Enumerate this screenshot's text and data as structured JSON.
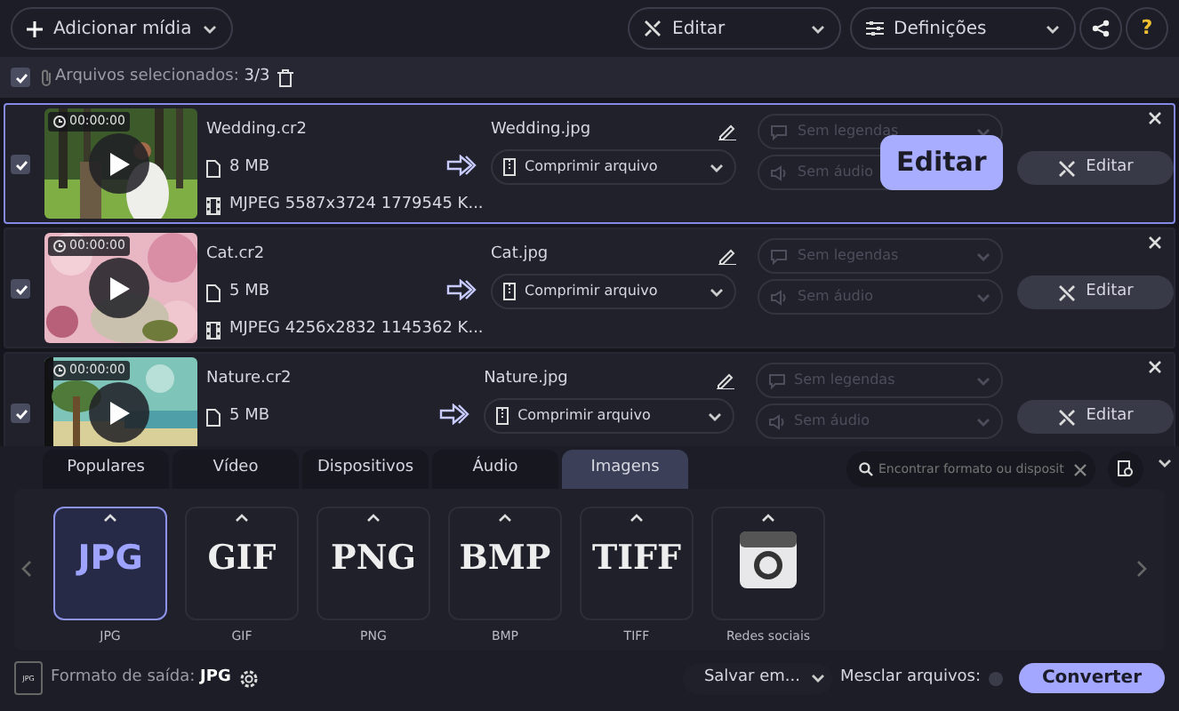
{
  "toolbar": {
    "add_button": "Adicionar mídia",
    "edit_menu": "Editar",
    "settings_menu": "Definições",
    "help_button": "?"
  },
  "selection": {
    "checked": true,
    "label": "Arquivos selecionados:",
    "count": "3/3"
  },
  "files": [
    {
      "checked": true,
      "selected": true,
      "duration": "00:00:00",
      "name": "Wedding.cr2",
      "size": "8 MB",
      "codec": "MJPEG 5587x3724 1779545 K...",
      "output_name": "Wedding.jpg",
      "compression": "Comprimir arquivo",
      "subtitles": "Sem legendas",
      "audio": "Sem áudio",
      "edit_button": "Editar",
      "kind": "picture"
    },
    {
      "checked": true,
      "selected": false,
      "duration": "00:00:00",
      "name": "Cat.cr2",
      "size": "5 MB",
      "codec": "MJPEG 4256x2832 1145362 K...",
      "output_name": "Cat.jpg",
      "compression": "Comprimir arquivo",
      "subtitles": "Sem legendas",
      "audio": "Sem áudio",
      "edit_button": "Editar",
      "kind": "picture"
    },
    {
      "checked": true,
      "selected": false,
      "duration": "00:00:00",
      "name": "Nature.cr2",
      "size": "5 MB",
      "output_name": "Nature.jpg",
      "compression": "Comprimir arquivo",
      "subtitles": "Sem legendas",
      "audio": "Sem áudio",
      "edit_button": "Editar",
      "kind": "picture"
    }
  ],
  "tooltip": "Editar",
  "tabs": [
    {
      "label": "Populares",
      "selected": false
    },
    {
      "label": "Vídeo",
      "selected": false
    },
    {
      "label": "Dispositivos",
      "selected": false
    },
    {
      "label": "Áudio",
      "selected": false
    },
    {
      "label": "Imagens",
      "selected": true
    }
  ],
  "search": {
    "placeholder": "Encontrar formato ou disposit"
  },
  "formats": [
    {
      "kind": "text",
      "logo": "JPG",
      "label": "JPG",
      "selected": true
    },
    {
      "kind": "text",
      "logo": "GIF",
      "label": "GIF",
      "selected": false
    },
    {
      "kind": "text",
      "logo": "PNG",
      "label": "PNG",
      "selected": false
    },
    {
      "kind": "text",
      "logo": "BMP",
      "label": "BMP",
      "selected": false
    },
    {
      "kind": "text",
      "logo": "TIFF",
      "label": "TIFF",
      "selected": false
    },
    {
      "kind": "camera",
      "label": "Redes sociais",
      "selected": false
    }
  ],
  "footer": {
    "file_icon_label": "JPG",
    "output_label": "Formato de saída:",
    "output_format": "JPG",
    "save_button": "Salvar em...",
    "merge_label": "Mesclar arquivos:",
    "merge_on": false,
    "convert_button": "Converter"
  }
}
